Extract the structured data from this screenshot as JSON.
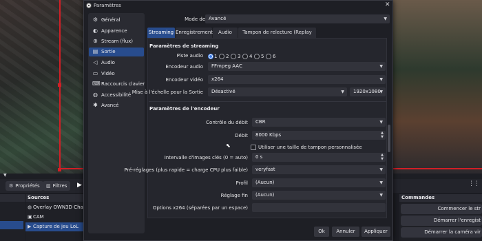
{
  "window": {
    "title": "Paramètres",
    "close_symbol": "✕"
  },
  "sidebar": {
    "items": [
      {
        "label": "Général",
        "icon": "gear-icon",
        "glyph": "⚙",
        "selected": false
      },
      {
        "label": "Apparence",
        "icon": "palette-icon",
        "glyph": "◐",
        "selected": false
      },
      {
        "label": "Stream (flux)",
        "icon": "globe-icon",
        "glyph": "⊕",
        "selected": false
      },
      {
        "label": "Sortie",
        "icon": "output-icon",
        "glyph": "▤",
        "selected": true
      },
      {
        "label": "Audio",
        "icon": "speaker-icon",
        "glyph": "◁",
        "selected": false
      },
      {
        "label": "Vidéo",
        "icon": "monitor-icon",
        "glyph": "▭",
        "selected": false
      },
      {
        "label": "Raccourcis clavier",
        "icon": "keyboard-icon",
        "glyph": "⌨",
        "selected": false
      },
      {
        "label": "Accessibilité",
        "icon": "accessibility-icon",
        "glyph": "◍",
        "selected": false
      },
      {
        "label": "Avancé",
        "icon": "wrench-icon",
        "glyph": "✱",
        "selected": false
      }
    ]
  },
  "output_mode": {
    "label": "Mode de Sortie",
    "value": "Avancé"
  },
  "tabs": [
    {
      "label": "Streaming",
      "selected": true
    },
    {
      "label": "Enregistrement",
      "selected": false
    },
    {
      "label": "Audio",
      "selected": false
    },
    {
      "label": "Tampon de relecture (Replay Buffer)",
      "selected": false
    }
  ],
  "streaming": {
    "section_title": "Paramètres de streaming",
    "audio_track": {
      "label": "Piste audio",
      "options": [
        "1",
        "2",
        "3",
        "4",
        "5",
        "6"
      ],
      "selected": "1"
    },
    "audio_encoder": {
      "label": "Encodeur audio",
      "value": "FFmpeg AAC"
    },
    "video_encoder": {
      "label": "Encodeur vidéo",
      "value": "x264"
    },
    "rescale": {
      "label": "Mise à l'échelle pour la Sortie",
      "value": "Désactivé",
      "resolution": "1920x1080"
    }
  },
  "encoder": {
    "section_title": "Paramètres de l'encodeur",
    "rate_control": {
      "label": "Contrôle du débit",
      "value": "CBR"
    },
    "bitrate": {
      "label": "Débit",
      "value": "8000 Kbps"
    },
    "custom_buffer": {
      "label": "Utiliser une taille de tampon personnalisée",
      "checked": false
    },
    "keyframe": {
      "label": "Intervalle d'images clés (0 = auto)",
      "value": "0 s"
    },
    "preset": {
      "label": "Pré-réglages (plus rapide = charge CPU plus faible)",
      "value": "veryfast"
    },
    "profile": {
      "label": "Profil",
      "value": "(Aucun)"
    },
    "tune": {
      "label": "Réglage fin",
      "value": "(Aucun)"
    },
    "x264_options": {
      "label": "Options x264 (séparées par un espace)",
      "value": ""
    }
  },
  "footer": {
    "ok": "Ok",
    "cancel": "Annuler",
    "apply": "Appliquer"
  },
  "main_window": {
    "toolbar": {
      "properties": "Propriétés",
      "filters": "Filtres"
    },
    "sources_title": "Sources",
    "sources": [
      {
        "label": "Overlay OWN3D Champio",
        "icon": "globe-icon",
        "glyph": "◍",
        "selected": false
      },
      {
        "label": "CAM",
        "icon": "camera-icon",
        "glyph": "▣",
        "selected": false
      },
      {
        "label": "Capture de jeu LoL",
        "icon": "game-capture-icon",
        "glyph": "▶",
        "selected": true
      }
    ],
    "controls_title": "Commandes",
    "controls": [
      "Commencer le str",
      "Démarrer l'enregist",
      "Démarrer la caméra vir"
    ]
  },
  "colors": {
    "accent": "#284c8d",
    "dialog_bg": "#1e1f25",
    "preview_border": "#d21f26"
  }
}
